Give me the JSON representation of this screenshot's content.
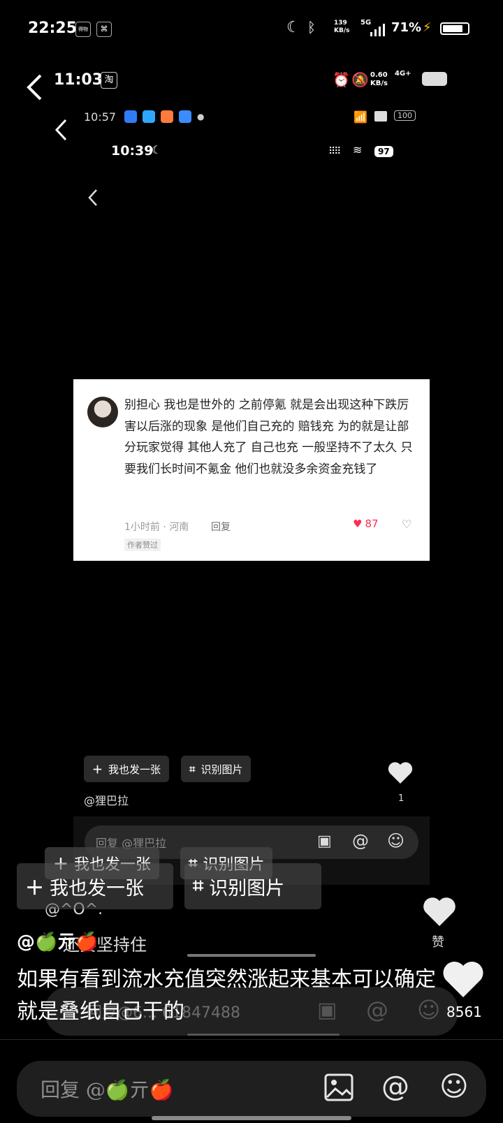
{
  "status_bar": {
    "time": "22:25",
    "speed": "139\nKB/s",
    "network": "5G",
    "battery": "71%",
    "app_icon_1": "得物",
    "app_icon_2": "capcut-icon"
  },
  "layer1": {
    "time": "11:03",
    "app_badge": "淘",
    "speed": "0.60\nKB/s",
    "network": "4G+"
  },
  "layer2": {
    "time": "10:57",
    "battery": "100"
  },
  "layer3": {
    "time": "10:39",
    "battery": "97"
  },
  "comment_card": {
    "text": "别担心 我也是世外的 之前停氪 就是会出现这种下跌厉害以后涨的现象 是他们自己充的 赔钱充 为的就是让部分玩家觉得 其他人充了 自己也充 一般坚持不了太久 只要我们长时间不氪金 他们也就没多余资金充钱了",
    "meta": "1小时前 · 河南",
    "reply": "回复",
    "badge": "作者赞过",
    "likes": "87"
  },
  "inner_post": {
    "btn_post": "我也发一张",
    "btn_recognize": "识别图片",
    "author": "@狸巴拉",
    "like_count": "1",
    "reply_placeholder": "回复 @狸巴拉"
  },
  "mid_post": {
    "btn_post": "我也发一张",
    "btn_recognize": "识别图片",
    "author_partial": "@^O^.",
    "reply_placeholder": "回复@6... 61847488",
    "like_label": "赞"
  },
  "outer_post": {
    "btn_post": "我也发一张",
    "btn_recognize": "识别图片",
    "author": "@🍏亓🍎",
    "author_overlap": "还要坚持住",
    "caption": "如果有看到流水充值突然涨起来基本可以确定就是叠纸自己干的",
    "like_count": "8561",
    "reply_placeholder": "回复 @🍏亓🍎"
  },
  "colors": {
    "background": "#000000",
    "like_red": "#fe2c55",
    "chip_dark": "#2a2a2a",
    "bar_dark": "#1f1f1f"
  }
}
